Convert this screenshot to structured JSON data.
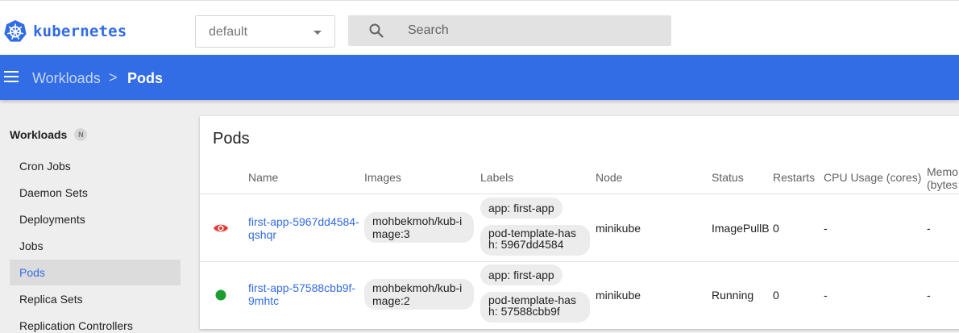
{
  "header": {
    "brand": "kubernetes",
    "namespace": "default",
    "search_placeholder": "Search"
  },
  "breadcrumb": {
    "parent": "Workloads",
    "separator": ">",
    "current": "Pods"
  },
  "sidebar": {
    "section": "Workloads",
    "badge": "N",
    "items": [
      {
        "label": "Cron Jobs"
      },
      {
        "label": "Daemon Sets"
      },
      {
        "label": "Deployments"
      },
      {
        "label": "Jobs"
      },
      {
        "label": "Pods"
      },
      {
        "label": "Replica Sets"
      },
      {
        "label": "Replication Controllers"
      }
    ],
    "active_item": "Pods"
  },
  "pods": {
    "title": "Pods",
    "columns": [
      "Name",
      "Images",
      "Labels",
      "Node",
      "Status",
      "Restarts",
      "CPU Usage (cores)",
      "Memo (bytes"
    ],
    "rows": [
      {
        "status_icon": "eye-icon",
        "name": "first-app-5967dd4584-qshqr",
        "image": "mohbekmoh/kub-image:3",
        "label_app": "app: first-app",
        "label_hash": "pod-template-hash: 5967dd4584",
        "node": "minikube",
        "status": "ImagePullB",
        "restarts": "0",
        "cpu": "-",
        "memory": "-"
      },
      {
        "status_icon": "running-dot-icon",
        "name": "first-app-57588cbb9f-9mhtc",
        "image": "mohbekmoh/kub-image:2",
        "label_app": "app: first-app",
        "label_hash": "pod-template-hash: 57588cbb9f",
        "node": "minikube",
        "status": "Running",
        "restarts": "0",
        "cpu": "-",
        "memory": "-"
      }
    ]
  },
  "colors": {
    "primary": "#326ce5",
    "error": "#e53935",
    "success": "#1b9e2f"
  }
}
